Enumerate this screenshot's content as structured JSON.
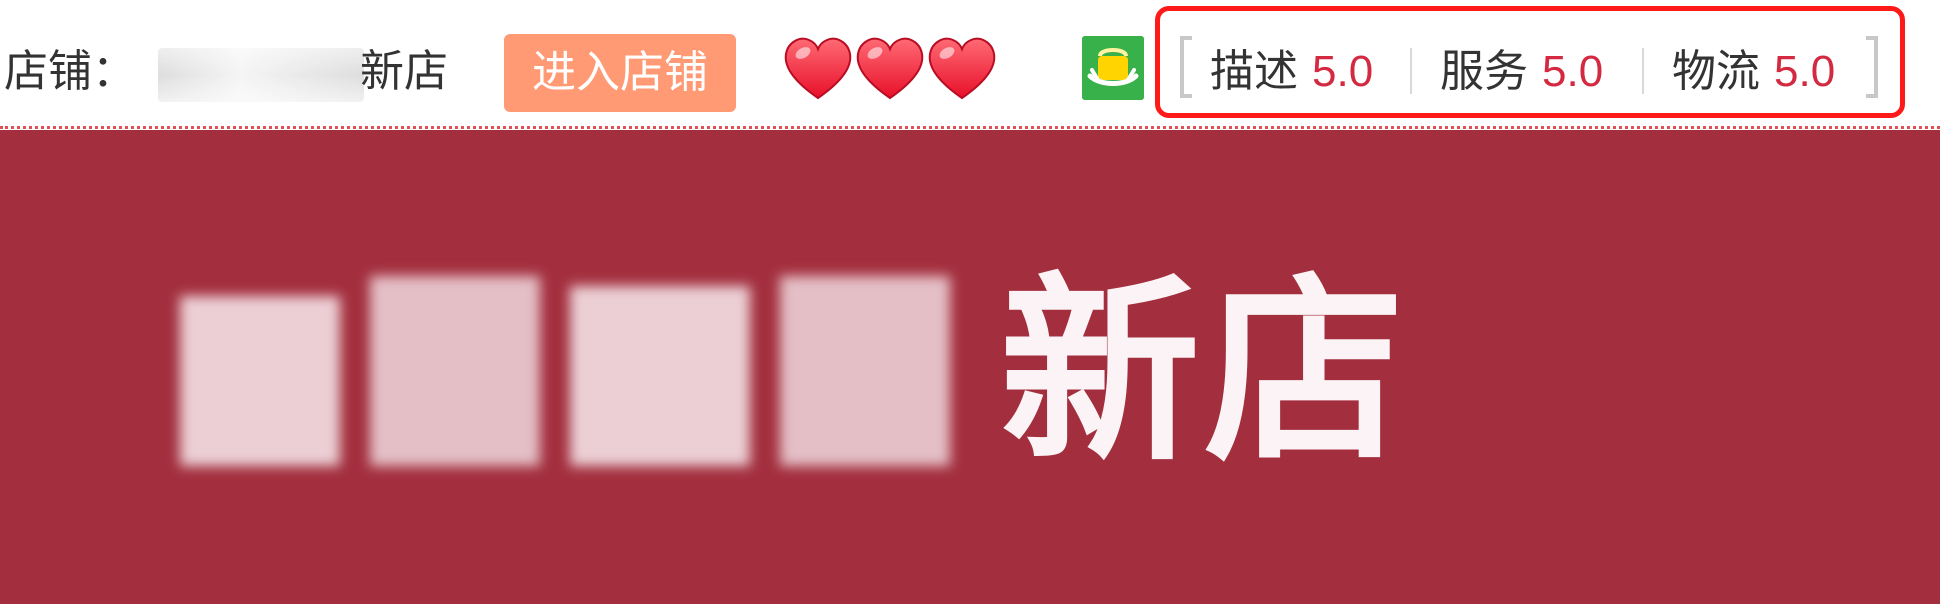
{
  "shop_bar": {
    "label": "店铺：",
    "shop_name_visible_suffix": "新店",
    "enter_button_label": "进入店铺",
    "heart_count": 3,
    "heart_color": "#ff2a3d",
    "badge_color": "#38b14a",
    "ratings": [
      {
        "label": "描述",
        "value": "5.0"
      },
      {
        "label": "服务",
        "value": "5.0"
      },
      {
        "label": "物流",
        "value": "5.0"
      }
    ],
    "highlight_color": "#ff1a1a",
    "value_color": "#d42a41"
  },
  "banner": {
    "background_color": "#a32f3e",
    "title_visible_suffix": "新店"
  }
}
